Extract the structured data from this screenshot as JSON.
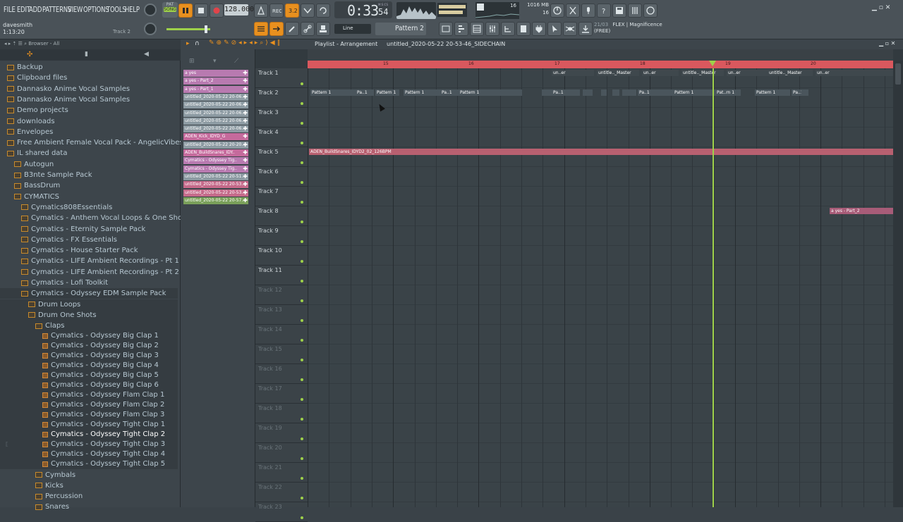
{
  "menu": [
    "FILE",
    "EDIT",
    "ADD",
    "PATTERNS",
    "VIEW",
    "OPTIONS",
    "TOOLS",
    "HELP"
  ],
  "transport": {
    "mode_top": "PAT",
    "mode_bottom": "SONG",
    "tempo": "128.000",
    "time": "0:33",
    "time_small": "54",
    "time_unit": "M:S:CS"
  },
  "user": {
    "name": "davesmith",
    "position": "1:13:20",
    "track_hint": "Track 2"
  },
  "meters": {
    "cpu_value": "16",
    "ram_value": "1016 MB",
    "poly_value": "16"
  },
  "pattern_selector": {
    "snap": "Line",
    "pattern": "Pattern 2"
  },
  "news": {
    "counter": "21/03",
    "line1": "FLEX | Magnificence",
    "line2": "(FREE)"
  },
  "browser": {
    "header": "Browser - All",
    "items": [
      {
        "label": "Backup",
        "indent": 0,
        "type": "folder"
      },
      {
        "label": "Clipboard files",
        "indent": 0,
        "type": "folder"
      },
      {
        "label": "Dannasko Anime Vocal Samples",
        "indent": 0,
        "type": "folder"
      },
      {
        "label": "Dannasko Anime Vocal Samples",
        "indent": 0,
        "type": "folder"
      },
      {
        "label": "Demo projects",
        "indent": 0,
        "type": "folder"
      },
      {
        "label": "downloads",
        "indent": 0,
        "type": "folder"
      },
      {
        "label": "Envelopes",
        "indent": 0,
        "type": "folder"
      },
      {
        "label": "Free Ambient Female Vocal Pack - AngelicVibes",
        "indent": 0,
        "type": "folder"
      },
      {
        "label": "IL shared data",
        "indent": 0,
        "type": "folder"
      },
      {
        "label": "Autogun",
        "indent": 1,
        "type": "folder"
      },
      {
        "label": "B3nte Sample Pack",
        "indent": 1,
        "type": "folder"
      },
      {
        "label": "BassDrum",
        "indent": 1,
        "type": "folder"
      },
      {
        "label": "CYMATICS",
        "indent": 1,
        "type": "folder"
      },
      {
        "label": "Cymatics808Essentials",
        "indent": 2,
        "type": "folder"
      },
      {
        "label": "Cymatics - Anthem Vocal Loops & One Shots",
        "indent": 2,
        "type": "folder"
      },
      {
        "label": "Cymatics - Eternity Sample Pack",
        "indent": 2,
        "type": "folder"
      },
      {
        "label": "Cymatics - FX Essentials",
        "indent": 2,
        "type": "folder"
      },
      {
        "label": "Cymatics - House Starter Pack",
        "indent": 2,
        "type": "folder"
      },
      {
        "label": "Cymatics - LIFE Ambient Recordings - Pt 1",
        "indent": 2,
        "type": "folder"
      },
      {
        "label": "Cymatics - LIFE Ambient Recordings - Pt 2",
        "indent": 2,
        "type": "folder"
      },
      {
        "label": "Cymatics - Lofi Toolkit",
        "indent": 2,
        "type": "folder"
      },
      {
        "label": "Cymatics - Odyssey EDM Sample Pack",
        "indent": 2,
        "type": "folder"
      },
      {
        "label": "Drum Loops",
        "indent": 3,
        "type": "folder"
      },
      {
        "label": "Drum One Shots",
        "indent": 3,
        "type": "folder"
      },
      {
        "label": "Claps",
        "indent": 4,
        "type": "folder"
      },
      {
        "label": "Cymatics - Odyssey Big Clap 1",
        "indent": 5,
        "type": "file"
      },
      {
        "label": "Cymatics - Odyssey Big Clap 2",
        "indent": 5,
        "type": "file"
      },
      {
        "label": "Cymatics - Odyssey Big Clap 3",
        "indent": 5,
        "type": "file"
      },
      {
        "label": "Cymatics - Odyssey Big Clap 4",
        "indent": 5,
        "type": "file"
      },
      {
        "label": "Cymatics - Odyssey Big Clap 5",
        "indent": 5,
        "type": "file"
      },
      {
        "label": "Cymatics - Odyssey Big Clap 6",
        "indent": 5,
        "type": "file"
      },
      {
        "label": "Cymatics - Odyssey Flam Clap 1",
        "indent": 5,
        "type": "file"
      },
      {
        "label": "Cymatics - Odyssey Flam Clap 2",
        "indent": 5,
        "type": "file"
      },
      {
        "label": "Cymatics - Odyssey Flam Clap 3",
        "indent": 5,
        "type": "file"
      },
      {
        "label": "Cymatics - Odyssey Tight Clap 1",
        "indent": 5,
        "type": "file"
      },
      {
        "label": "Cymatics - Odyssey Tight Clap 2",
        "indent": 5,
        "type": "file"
      },
      {
        "label": "Cymatics - Odyssey Tight Clap 3",
        "indent": 5,
        "type": "file"
      },
      {
        "label": "Cymatics - Odyssey Tight Clap 4",
        "indent": 5,
        "type": "file"
      },
      {
        "label": "Cymatics - Odyssey Tight Clap 5",
        "indent": 5,
        "type": "file"
      },
      {
        "label": "Cymbals",
        "indent": 4,
        "type": "folder"
      },
      {
        "label": "Kicks",
        "indent": 4,
        "type": "folder"
      },
      {
        "label": "Percussion",
        "indent": 4,
        "type": "folder"
      },
      {
        "label": "Snares",
        "indent": 4,
        "type": "folder"
      }
    ]
  },
  "picker": [
    {
      "label": "a yes",
      "color": "#b87ab0"
    },
    {
      "label": "a yes - Part_2",
      "color": "#b87ab0"
    },
    {
      "label": "a yes - Part_1",
      "color": "#b87ab0"
    },
    {
      "label": "untitled_2020-05-22 20-06..",
      "color": "#8c9aa2"
    },
    {
      "label": "untitled_2020-05-22 20-06..",
      "color": "#8c9aa2"
    },
    {
      "label": "untitled_2020-05-22 20-06..",
      "color": "#8c9aa2"
    },
    {
      "label": "untitled_2020-05-22 20-06..",
      "color": "#8c9aa2"
    },
    {
      "label": "untitled_2020-05-22 20-06..",
      "color": "#8c9aa2"
    },
    {
      "label": "ADEN_Kick_IDYD_G",
      "color": "#c56a9c"
    },
    {
      "label": "untitled_2020-05-22 20-20..",
      "color": "#8c9aa2"
    },
    {
      "label": "ADEN_BuildSnares_IDY..",
      "color": "#c56a9c"
    },
    {
      "label": "Cymatics - Odyssey Tig..",
      "color": "#b87ab0"
    },
    {
      "label": "Cymatics - Odyssey Tig..",
      "color": "#b87ab0"
    },
    {
      "label": "untitled_2020-05-22 20-51..",
      "color": "#8c9aa2"
    },
    {
      "label": "untitled_2020-05-22 20-53..",
      "color": "#c56a8a"
    },
    {
      "label": "untitled_2020-05-22 20-53..",
      "color": "#c56a8a"
    },
    {
      "label": "untitled_2020-05-22 20-57..",
      "color": "#7aa05a"
    }
  ],
  "playlist": {
    "title": "Playlist - Arrangement",
    "crumb": "untitled_2020-05-22 20-53-46_SIDECHAIN",
    "ruler_marks": [
      "15",
      "16",
      "17",
      "18",
      "19",
      "20"
    ],
    "tracks": [
      "Track 1",
      "Track 2",
      "Track 3",
      "Track 4",
      "Track 5",
      "Track 6",
      "Track 7",
      "Track 8",
      "Track 9",
      "Track 10",
      "Track 11",
      "Track 12",
      "Track 13",
      "Track 14",
      "Track 15",
      "Track 16",
      "Track 17",
      "Track 18",
      "Track 19",
      "Track 20",
      "Track 21",
      "Track 22",
      "Track 23"
    ],
    "clips": {
      "track1": "untitle.._Master",
      "track1_short": "un..er",
      "track2_pattern": "Pattern 1",
      "track2_pa": "Pa..1",
      "track2_partn": "Pat..rn 1",
      "track5": "ADEN_BuildSnares_IDYD2_02_126BPM",
      "track8": "a yes - Part_2"
    }
  },
  "colors": {
    "accent": "#e8901f",
    "ruler": "#d9585e",
    "playhead": "#9ed14a",
    "clip_pattern": "#7d8c96",
    "clip_audio": "#b86070",
    "clip_pink": "#a85c78"
  }
}
